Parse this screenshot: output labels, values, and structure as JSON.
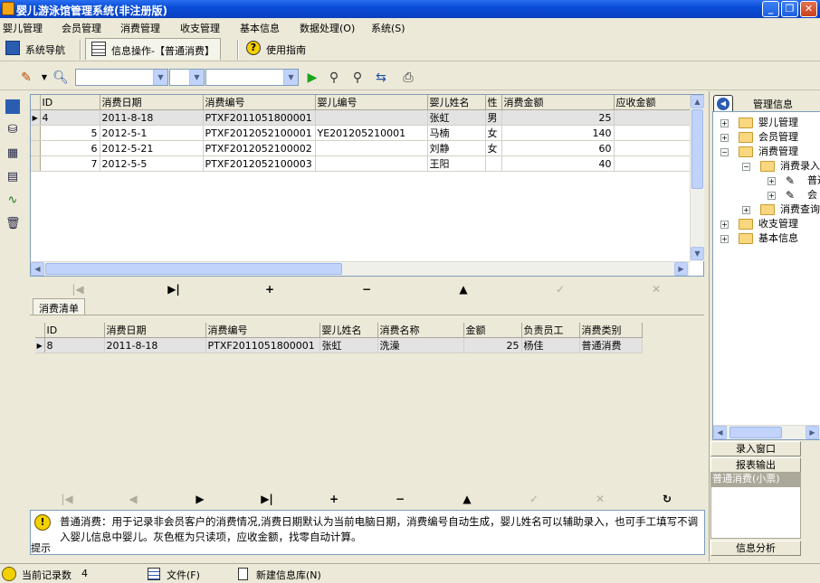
{
  "window": {
    "title": "婴儿游泳馆管理系统(非注册版)"
  },
  "menu": [
    {
      "label": "婴儿管理"
    },
    {
      "label": "会员管理"
    },
    {
      "label": "消费管理"
    },
    {
      "label": "收支管理"
    },
    {
      "label": "基本信息"
    },
    {
      "label": "数据处理(O)"
    },
    {
      "label": "系统(S)"
    }
  ],
  "tabs": [
    {
      "label": "系统导航"
    },
    {
      "label": "信息操作-【普通消费】"
    },
    {
      "label": "使用指南"
    }
  ],
  "main_grid": {
    "columns": [
      "ID",
      "消费日期",
      "消费编号",
      "婴儿编号",
      "婴儿姓名",
      "性",
      "消费金额",
      "应收金额"
    ],
    "rows": [
      {
        "id": "4",
        "date": "2011-8-18",
        "code": "PTXF2011051800001",
        "baby_code": "",
        "name": "张虹",
        "sex": "男",
        "amount": "25",
        "due": ""
      },
      {
        "id": "5",
        "date": "2012-5-1",
        "code": "PTXF2012052100001",
        "baby_code": "YE201205210001",
        "name": "马楠",
        "sex": "女",
        "amount": "140",
        "due": ""
      },
      {
        "id": "6",
        "date": "2012-5-21",
        "code": "PTXF2012052100002",
        "baby_code": "",
        "name": "刘静",
        "sex": "女",
        "amount": "60",
        "due": ""
      },
      {
        "id": "7",
        "date": "2012-5-5",
        "code": "PTXF2012052100003",
        "baby_code": "",
        "name": "王阳",
        "sex": "",
        "amount": "40",
        "due": ""
      }
    ]
  },
  "detail": {
    "tab_label": "消费清单",
    "columns": [
      "ID",
      "消费日期",
      "消费编号",
      "婴儿姓名",
      "消费名称",
      "金额",
      "负责员工",
      "消费类别"
    ],
    "rows": [
      {
        "id": "8",
        "date": "2011-8-18",
        "code": "PTXF2011051800001",
        "name": "张虹",
        "item": "洗澡",
        "amount": "25",
        "staff": "杨佳",
        "category": "普通消费"
      }
    ]
  },
  "hint": {
    "text": "普通消费：用于记录非会员客户的消费情况,消费日期默认为当前电脑日期，消费编号自动生成，婴儿姓名可以辅助录入，也可手工填写不调入婴儿信息中婴儿。灰色框为只读项，应收金额，找零自动计算。",
    "label": "提示"
  },
  "right_panel": {
    "header": "管理信息",
    "tree": [
      {
        "label": "婴儿管理"
      },
      {
        "label": "会员管理"
      },
      {
        "label": "消费管理"
      },
      {
        "label": "消费录入"
      },
      {
        "label": "普通"
      },
      {
        "label": "会"
      },
      {
        "label": "消费查询"
      },
      {
        "label": "收支管理"
      },
      {
        "label": "基本信息"
      }
    ],
    "buttons": [
      "录入窗口",
      "报表输出"
    ],
    "selected_item": "普通消费(小票)",
    "bottom_button": "信息分析"
  },
  "status": {
    "record_label": "当前记录数",
    "record_count": "4",
    "file_label": "文件(F)",
    "new_db_label": "新建信息库(N)"
  },
  "colors": {
    "titlebar": "#0a4ed8",
    "window_bg": "#ece9d8",
    "grid_border": "#7f9db9"
  }
}
